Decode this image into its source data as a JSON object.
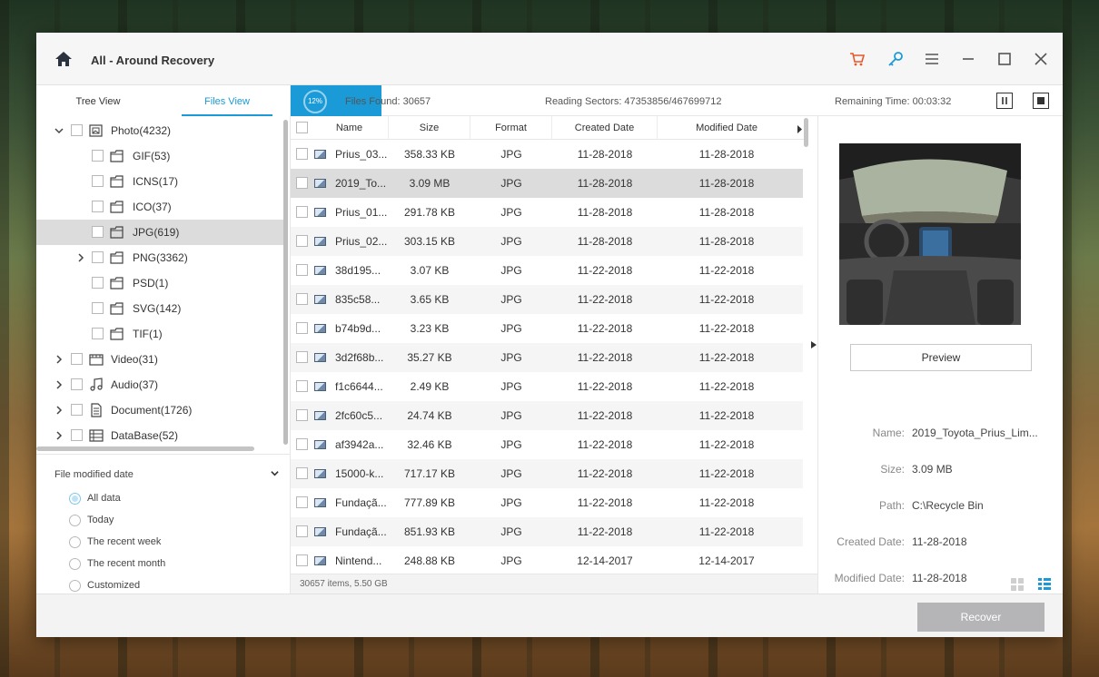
{
  "app": {
    "title": "All - Around Recovery"
  },
  "titlebar": {
    "icons": [
      "home-icon",
      "cart-icon",
      "key-icon",
      "menu-icon",
      "minimize-icon",
      "maximize-icon",
      "close-icon"
    ]
  },
  "tabs": [
    {
      "label": "Tree View"
    },
    {
      "label": "Files View",
      "active": true
    }
  ],
  "tree": [
    {
      "label": "Photo(4232)",
      "icon": "photo-folder-icon",
      "expanded": true
    },
    {
      "label": "GIF(53)",
      "icon": "folder-icon"
    },
    {
      "label": "ICNS(17)",
      "icon": "folder-icon"
    },
    {
      "label": "ICO(37)",
      "icon": "folder-icon"
    },
    {
      "label": "JPG(619)",
      "icon": "folder-icon",
      "selected": true
    },
    {
      "label": "PNG(3362)",
      "icon": "folder-icon"
    },
    {
      "label": "PSD(1)",
      "icon": "folder-icon"
    },
    {
      "label": "SVG(142)",
      "icon": "folder-icon"
    },
    {
      "label": "TIF(1)",
      "icon": "folder-icon"
    },
    {
      "label": "Video(31)",
      "icon": "video-icon"
    },
    {
      "label": "Audio(37)",
      "icon": "audio-icon"
    },
    {
      "label": "Document(1726)",
      "icon": "document-icon"
    },
    {
      "label": "DataBase(52)",
      "icon": "database-icon"
    }
  ],
  "filter": {
    "title": "File modified date",
    "options": [
      "All data",
      "Today",
      "The recent week",
      "The recent month",
      "Customized"
    ],
    "selected": "All data"
  },
  "scan": {
    "progress_label": "12%",
    "progress": 0.12,
    "files_found": "Files Found:  30657",
    "reading_sectors": "Reading Sectors:  47353856/467699712",
    "remaining_time": "Remaining Time: 00:03:32"
  },
  "table": {
    "columns": [
      "Name",
      "Size",
      "Format",
      "Created Date",
      "Modified Date"
    ],
    "rows": [
      [
        "Prius_03...",
        "358.33 KB",
        "JPG",
        "11-28-2018",
        "11-28-2018"
      ],
      [
        "2019_To...",
        "3.09 MB",
        "JPG",
        "11-28-2018",
        "11-28-2018"
      ],
      [
        "Prius_01...",
        "291.78 KB",
        "JPG",
        "11-28-2018",
        "11-28-2018"
      ],
      [
        "Prius_02...",
        "303.15 KB",
        "JPG",
        "11-28-2018",
        "11-28-2018"
      ],
      [
        "38d195...",
        "3.07 KB",
        "JPG",
        "11-22-2018",
        "11-22-2018"
      ],
      [
        "835c58...",
        "3.65 KB",
        "JPG",
        "11-22-2018",
        "11-22-2018"
      ],
      [
        "b74b9d...",
        "3.23 KB",
        "JPG",
        "11-22-2018",
        "11-22-2018"
      ],
      [
        "3d2f68b...",
        "35.27 KB",
        "JPG",
        "11-22-2018",
        "11-22-2018"
      ],
      [
        "f1c6644...",
        "2.49 KB",
        "JPG",
        "11-22-2018",
        "11-22-2018"
      ],
      [
        "2fc60c5...",
        "24.74 KB",
        "JPG",
        "11-22-2018",
        "11-22-2018"
      ],
      [
        "af3942a...",
        "32.46 KB",
        "JPG",
        "11-22-2018",
        "11-22-2018"
      ],
      [
        "15000-k...",
        "717.17 KB",
        "JPG",
        "11-22-2018",
        "11-22-2018"
      ],
      [
        "Fundaçã...",
        "777.89 KB",
        "JPG",
        "11-22-2018",
        "11-22-2018"
      ],
      [
        "Fundaçã...",
        "851.93 KB",
        "JPG",
        "11-22-2018",
        "11-22-2018"
      ],
      [
        "Nintend...",
        "248.88 KB",
        "JPG",
        "12-14-2017",
        "12-14-2017"
      ]
    ],
    "selected_row": 1,
    "footer": "30657 items, 5.50 GB"
  },
  "details": {
    "preview_label": "Preview",
    "fields": [
      {
        "label": "Name:",
        "value": "2019_Toyota_Prius_Lim..."
      },
      {
        "label": "Size:",
        "value": "3.09 MB"
      },
      {
        "label": "Path:",
        "value": "C:\\Recycle Bin"
      },
      {
        "label": "Created Date:",
        "value": "11-28-2018"
      },
      {
        "label": "Modified Date:",
        "value": "11-28-2018"
      }
    ]
  },
  "footer": {
    "recover_label": "Recover"
  },
  "colors": {
    "accent": "#1a9ad6",
    "cart": "#e8572a",
    "recover_disabled": "#b5b5b8"
  }
}
